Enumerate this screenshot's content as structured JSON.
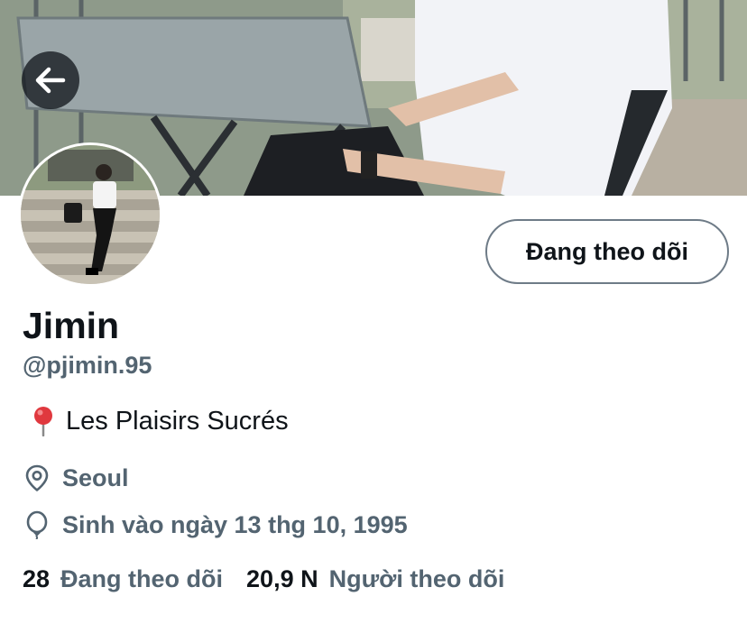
{
  "header": {
    "back_icon": "arrow-left-icon"
  },
  "profile": {
    "follow_button_label": "Đang theo dõi",
    "name": "Jimin",
    "handle": "@pjimin.95",
    "bio_icon": "round-pushpin-emoji",
    "bio_text": "Les Plaisirs Sucrés",
    "location_icon": "location-icon",
    "location": "Seoul",
    "birthday_icon": "balloon-icon",
    "birthday": "Sinh vào ngày 13 thg 10, 1995"
  },
  "stats": {
    "following_count": "28",
    "following_label": "Đang theo dõi",
    "followers_count": "20,9 N",
    "followers_label": "Người theo dõi"
  },
  "colors": {
    "primary_text": "#0f1419",
    "secondary_text": "#536471",
    "button_border": "#6e7b87"
  }
}
